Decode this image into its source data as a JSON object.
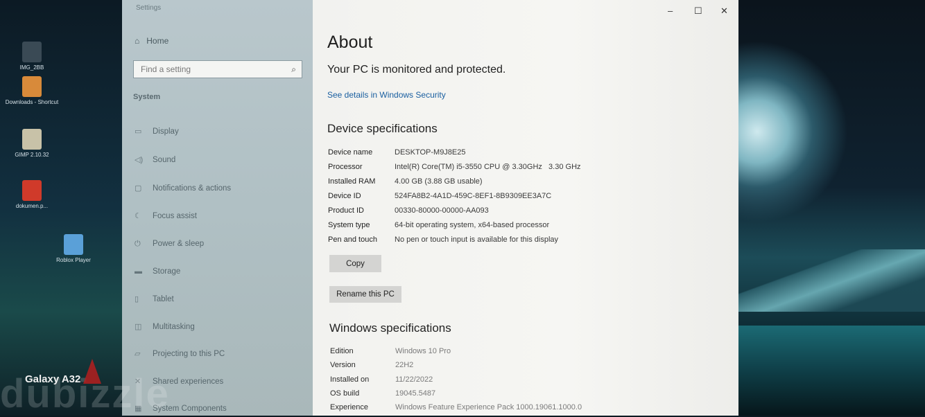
{
  "desktop": {
    "icons": [
      {
        "label": "IMG_2BB",
        "color": "#3a4a55"
      },
      {
        "label": "Downloads - Shortcut",
        "color": "#d88a3a"
      },
      {
        "label": "GIMP 2.10.32",
        "color": "#c8c2a8"
      },
      {
        "label": "dokumen.p...",
        "color": "#d03a2a"
      },
      {
        "label": "Roblox Player",
        "color": "#5aa0d8"
      }
    ],
    "phone_label": "Galaxy A32",
    "watermark": "dubizzle"
  },
  "settings": {
    "app_title": "Settings",
    "home_label": "Home",
    "search_placeholder": "Find a setting",
    "section_label": "System",
    "nav_items": [
      {
        "label": "Display",
        "icon": "display-icon"
      },
      {
        "label": "Sound",
        "icon": "sound-icon"
      },
      {
        "label": "Notifications & actions",
        "icon": "notifications-icon"
      },
      {
        "label": "Focus assist",
        "icon": "focus-assist-icon"
      },
      {
        "label": "Power & sleep",
        "icon": "power-icon"
      },
      {
        "label": "Storage",
        "icon": "storage-icon"
      },
      {
        "label": "Tablet",
        "icon": "tablet-icon"
      },
      {
        "label": "Multitasking",
        "icon": "multitasking-icon"
      },
      {
        "label": "Projecting to this PC",
        "icon": "projecting-icon"
      },
      {
        "label": "Shared experiences",
        "icon": "shared-experiences-icon"
      },
      {
        "label": "System Components",
        "icon": "components-icon"
      }
    ],
    "window_controls": {
      "minimize": "–",
      "maximize": "☐",
      "close": "✕"
    },
    "page_title": "About",
    "protection_status": "Your PC is monitored and protected.",
    "security_link": "See details in Windows Security",
    "device_specs": {
      "heading": "Device specifications",
      "rows": [
        {
          "key": "Device name",
          "value": "DESKTOP-M9J8E25"
        },
        {
          "key": "Processor",
          "value": "Intel(R) Core(TM) i5-3550 CPU @ 3.30GHz   3.30 GHz"
        },
        {
          "key": "Installed RAM",
          "value": "4.00 GB (3.88 GB usable)"
        },
        {
          "key": "Device ID",
          "value": "524FA8B2-4A1D-459C-8EF1-8B9309EE3A7C"
        },
        {
          "key": "Product ID",
          "value": "00330-80000-00000-AA093"
        },
        {
          "key": "System type",
          "value": "64-bit operating system, x64-based processor"
        },
        {
          "key": "Pen and touch",
          "value": "No pen or touch input is available for this display"
        }
      ]
    },
    "copy_button": "Copy",
    "rename_button": "Rename this PC",
    "windows_specs": {
      "heading": "Windows specifications",
      "rows": [
        {
          "key": "Edition",
          "value": "Windows 10 Pro"
        },
        {
          "key": "Version",
          "value": "22H2"
        },
        {
          "key": "Installed on",
          "value": "11/22/2022"
        },
        {
          "key": "OS build",
          "value": "19045.5487"
        },
        {
          "key": "Experience",
          "value": "Windows Feature Experience Pack 1000.19061.1000.0"
        }
      ]
    }
  }
}
